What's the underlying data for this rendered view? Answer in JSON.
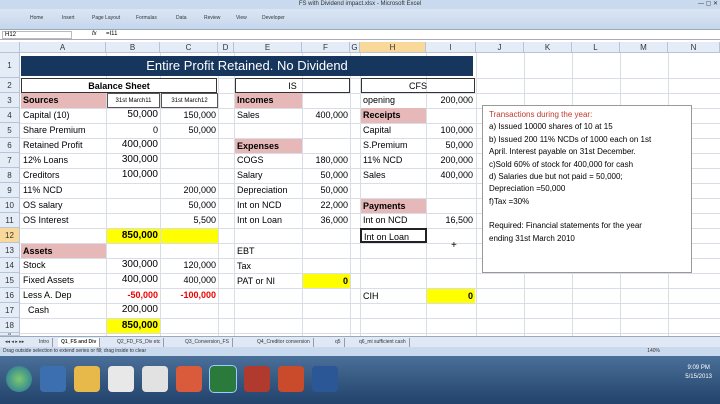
{
  "window_title": "FS with Dividend impact.xlsx - Microsoft Excel",
  "ribbon_tabs": [
    "Home",
    "Insert",
    "Page Layout",
    "Formulas",
    "Data",
    "Review",
    "View",
    "Developer"
  ],
  "name_box": "H12",
  "formula": "=I11",
  "columns": [
    "A",
    "B",
    "C",
    "D",
    "E",
    "F",
    "G",
    "H",
    "I",
    "J",
    "K",
    "L",
    "M",
    "N"
  ],
  "rows": [
    "1",
    "2",
    "3",
    "4",
    "5",
    "6",
    "7",
    "8",
    "9",
    "10",
    "11",
    "12",
    "13",
    "14",
    "15",
    "16",
    "17",
    "18",
    "19",
    "20"
  ],
  "banner": "Entire Profit Retained. No Dividend",
  "balance_sheet": {
    "title": "Balance Sheet",
    "sources_label": "Sources",
    "col1": "31st March11",
    "col2": "31st March12",
    "rows": [
      {
        "label": "Capital (10)",
        "v1": "50,000",
        "v2": "150,000"
      },
      {
        "label": "Share Premium",
        "v1": "0",
        "v2": "50,000"
      },
      {
        "label": "Retained Profit",
        "v1": "400,000",
        "v2": ""
      },
      {
        "label": "12% Loans",
        "v1": "300,000",
        "v2": ""
      },
      {
        "label": "Creditors",
        "v1": "100,000",
        "v2": ""
      },
      {
        "label": "11% NCD",
        "v1": "",
        "v2": "200,000"
      },
      {
        "label": "OS salary",
        "v1": "",
        "v2": "50,000"
      },
      {
        "label": "OS Interest",
        "v1": "",
        "v2": "5,500"
      }
    ],
    "total1": "850,000",
    "assets_label": "Assets",
    "asset_rows": [
      {
        "label": "Stock",
        "v1": "300,000",
        "v2": "120,000"
      },
      {
        "label": "Fixed Assets",
        "v1": "400,000",
        "v2": "400,000"
      },
      {
        "label": "Less A. Dep",
        "v1": "-50,000",
        "v2": "-100,000"
      },
      {
        "label": "Cash",
        "v1": "200,000",
        "v2": ""
      }
    ],
    "total2": "850,000"
  },
  "is": {
    "title": "IS",
    "incomes_label": "Incomes",
    "sales_label": "Sales",
    "sales_value": "400,000",
    "expenses_label": "Expenses",
    "expenses": [
      {
        "label": "COGS",
        "value": "180,000"
      },
      {
        "label": "Salary",
        "value": "50,000"
      },
      {
        "label": "Depreciation",
        "value": "50,000"
      },
      {
        "label": "Int on NCD",
        "value": "22,000"
      },
      {
        "label": "Int on Loan",
        "value": "36,000"
      }
    ],
    "ebt_label": "EBT",
    "tax_label": "Tax",
    "pat_label": "PAT or NI",
    "pat_value": "0"
  },
  "cfs": {
    "title": "CFS",
    "opening_label": "opening",
    "opening_value": "200,000",
    "receipts_label": "Receipts",
    "receipts": [
      {
        "label": "Capital",
        "value": "100,000"
      },
      {
        "label": "S.Premium",
        "value": "50,000"
      },
      {
        "label": "11% NCD",
        "value": "200,000"
      },
      {
        "label": "Sales",
        "value": "400,000"
      }
    ],
    "payments_label": "Payments",
    "payments": [
      {
        "label": "Int on NCD",
        "value": "16,500"
      },
      {
        "label": "Int on Loan",
        "value": ""
      }
    ],
    "cih_label": "CIH",
    "cih_value": "0"
  },
  "note": {
    "heading": "Transactions during the year:",
    "lines": [
      "a) Issued 10000 shares of 10 at 15",
      "b) Issued 200 11% NCDs of 1000 each on 1st",
      "April. Interest payable on 31st December.",
      "c)Sold 60% of stock for 400,000 for cash",
      "d) Salaries due but not paid = 50,000;",
      "Depreciation =50,000",
      "f)Tax =30%",
      "",
      "Required: Financial statements for the year",
      "ending 31st March 2010"
    ]
  },
  "sheet_tabs": [
    "Intro",
    "Q1_FS and Div",
    "Q2_FD_FS_Div etc",
    "Q3_Conversion_FS",
    "Q4_Creditor conversion",
    "q5",
    "q6_mi sufficient cash"
  ],
  "status_text": "Drag outside selection to extend series or fill; drag inside to clear",
  "zoom": "140%",
  "clock_time": "9:09 PM",
  "clock_date": "5/15/2013",
  "colors": {
    "banner": "#17365d",
    "header_pink": "#e6b9b8",
    "highlight": "#ffff00"
  }
}
